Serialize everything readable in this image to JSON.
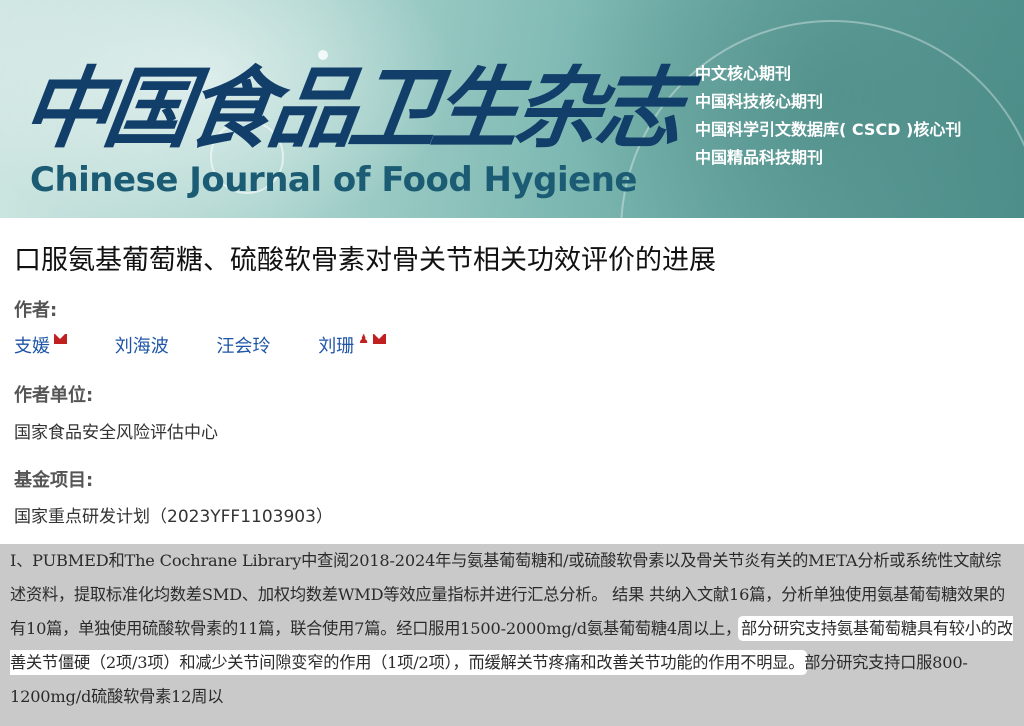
{
  "banner": {
    "cn_title": "中国食品卫生杂志",
    "en_title": "Chinese Journal of Food Hygiene",
    "badges": [
      "中文核心期刊",
      "中国科技核心期刊",
      "中国科学引文数据库( CSCD )核心刊",
      "中国精品科技期刊"
    ]
  },
  "article": {
    "title": "口服氨基葡萄糖、硫酸软骨素对骨关节相关功效评价的进展",
    "authors_label": "作者:",
    "authors": [
      {
        "name": "支媛",
        "icons": [
          "mail-icon"
        ]
      },
      {
        "name": "刘海波",
        "icons": []
      },
      {
        "name": "汪会玲",
        "icons": []
      },
      {
        "name": "刘珊",
        "icons": [
          "person-icon",
          "mail-icon"
        ]
      }
    ],
    "affiliation_label": "作者单位:",
    "affiliation": "国家食品安全风险评估中心",
    "fund_label": "基金项目:",
    "fund": "国家重点研发计划（2023YFF1103903）"
  },
  "abstract": {
    "seg1": "I、PUBMED和The Cochrane Library中查阅2018-2024年与氨基葡萄糖和/或硫酸软骨素以及骨关节炎有关的META分析或系统性文献综述资料，提取标准化均数差SMD、加权均数差WMD等效应量指标并进行汇总分析。 结果 共纳入文献16篇，分析单独使用氨基葡萄糖效果的有10篇，单独使用硫酸软骨素的11篇，联合使用7篇。经口服用1500-2000mg/d氨基葡萄糖4周以上，",
    "seg2_highlight": "部分研究支持氨基葡萄糖具有较小的改善关节僵硬（2项/3项）和减少关节间隙变窄的作用（1项/2项），而缓解关节疼痛和改善关节功能的作用不明显。",
    "seg3": "部分研究支持口服800-1200mg/d硫酸软骨素12周以"
  }
}
